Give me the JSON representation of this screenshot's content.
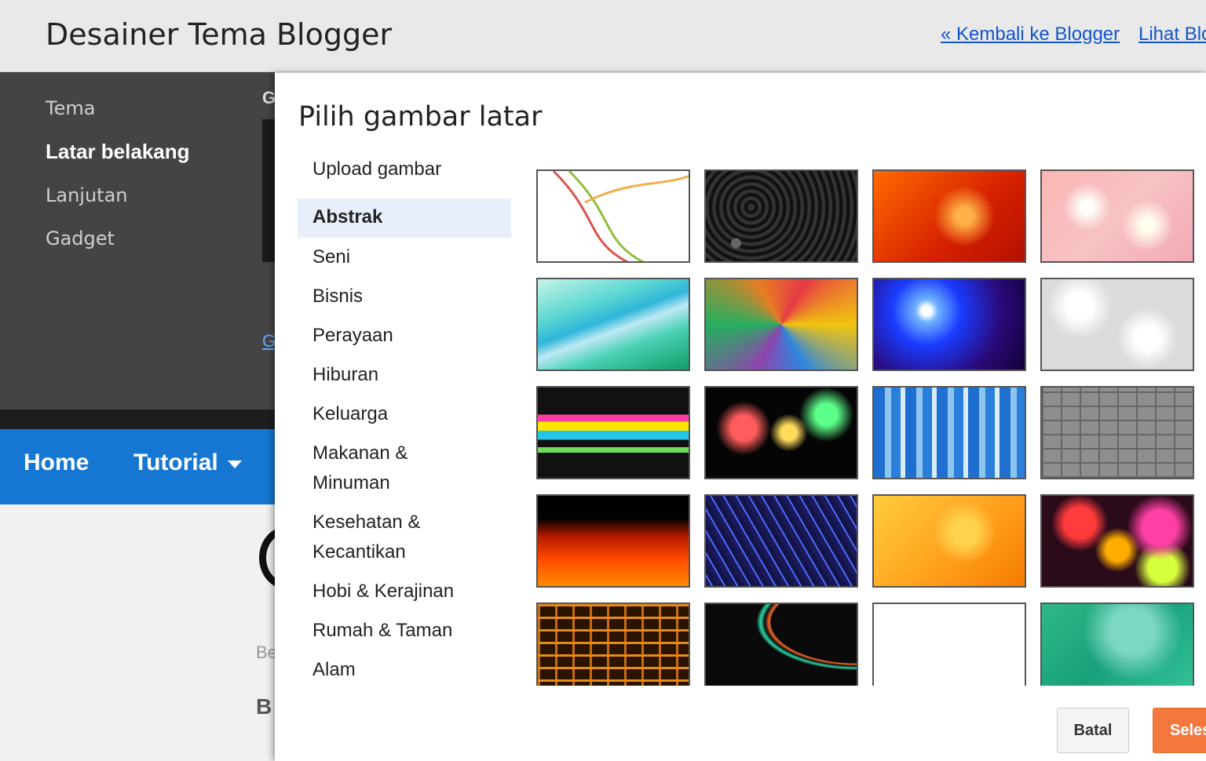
{
  "header": {
    "title": "Desainer Tema Blogger",
    "back_link": "« Kembali ke Blogger",
    "view_link": "Lihat Blog"
  },
  "sidebar": {
    "items": [
      {
        "label": "Tema",
        "active": false
      },
      {
        "label": "Latar belakang",
        "active": true
      },
      {
        "label": "Lanjutan",
        "active": false
      },
      {
        "label": "Gadget",
        "active": false
      }
    ],
    "partial_letter": "G",
    "partial_link": "G"
  },
  "preview": {
    "nav": {
      "home": "Home",
      "tutorial": "Tutorial"
    },
    "partial_text_1": "Be",
    "partial_text_2": "B"
  },
  "dialog": {
    "title": "Pilih gambar latar",
    "categories": [
      {
        "label": "Upload gambar"
      },
      {
        "label": "Abstrak",
        "selected": true
      },
      {
        "label": "Seni"
      },
      {
        "label": "Bisnis"
      },
      {
        "label": "Perayaan"
      },
      {
        "label": "Hiburan"
      },
      {
        "label": "Keluarga"
      },
      {
        "label": "Makanan & Minuman"
      },
      {
        "label": "Kesehatan & Kecantikan"
      },
      {
        "label": "Hobi & Kerajinan"
      },
      {
        "label": "Rumah & Taman"
      },
      {
        "label": "Alam"
      }
    ],
    "thumbnails": [
      "abstract-white-ribbons",
      "abstract-black-swirl",
      "abstract-red-bokeh",
      "abstract-pink-bokeh",
      "abstract-teal-waves",
      "abstract-graffiti",
      "abstract-blue-burst",
      "abstract-white-bokeh",
      "abstract-rainbow-stripes",
      "abstract-dark-bokeh",
      "abstract-blue-stripes",
      "abstract-gray-blocks",
      "abstract-fire",
      "abstract-blue-lines",
      "abstract-orange-swirls",
      "abstract-rainbow-bokeh",
      "abstract-orange-blocks",
      "abstract-neon-curves",
      "abstract-white-plain",
      "abstract-green-texture"
    ],
    "cancel_label": "Batal",
    "done_label": "Selesai"
  },
  "colors": {
    "accent_orange": "#f4783e",
    "nav_blue": "#1677d2",
    "link_blue": "#1155cc",
    "sidebar_dark": "#444444",
    "selected_category_bg": "#e8effb"
  }
}
